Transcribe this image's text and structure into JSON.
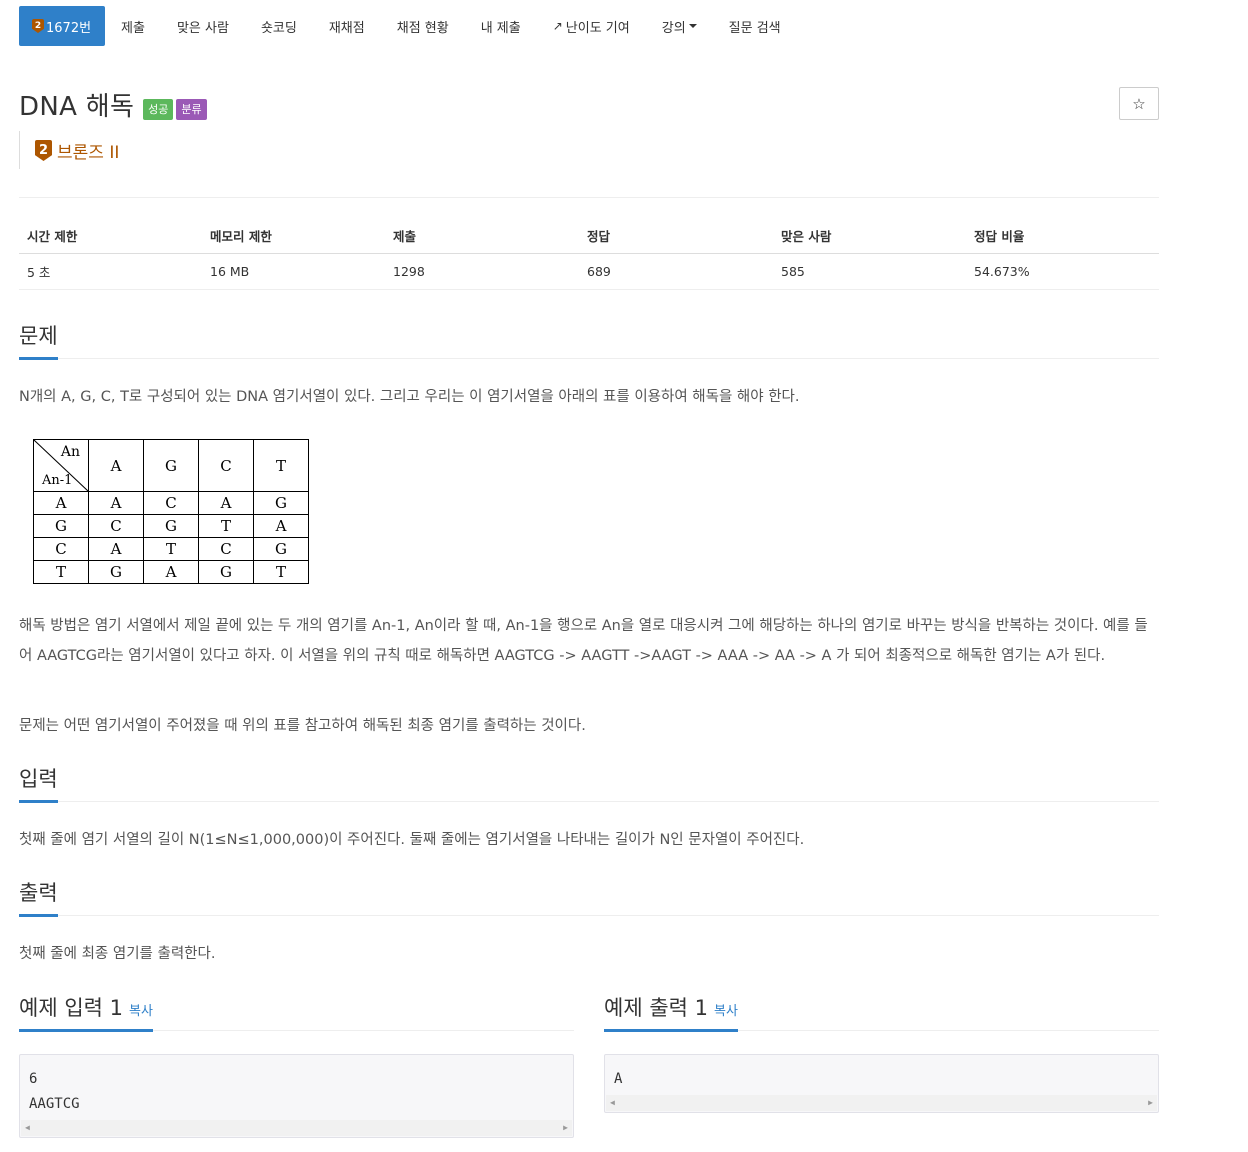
{
  "nav": {
    "active_tab": "1672번",
    "tier_digit": "2",
    "tabs": [
      "제출",
      "맞은 사람",
      "숏코딩",
      "재채점",
      "채점 현황",
      "내 제출",
      "난이도 기여",
      "강의",
      "질문 검색"
    ]
  },
  "problem": {
    "title": "DNA 해독",
    "labels": [
      "성공",
      "분류"
    ],
    "star": "☆",
    "tier_digit": "2",
    "tier_name": "브론즈 II"
  },
  "stats": {
    "headers": [
      "시간 제한",
      "메모리 제한",
      "제출",
      "정답",
      "맞은 사람",
      "정답 비율"
    ],
    "values": [
      "5 초",
      "16 MB",
      "1298",
      "689",
      "585",
      "54.673%"
    ]
  },
  "sections": {
    "problem_header": "문제",
    "problem_intro": "N개의 A, G, C, T로 구성되어 있는 DNA 염기서열이 있다. 그리고 우리는 이 염기서열을 아래의 표를 이용하여 해독을 해야 한다.",
    "problem_desc": "해독 방법은 염기 서열에서 제일 끝에 있는 두 개의 염기를 An-1, An이라 할 때, An-1을 행으로 An을 열로 대응시켜 그에 해당하는 하나의 염기로 바꾸는 방식을 반복하는 것이다.  예를 들어 AAGTCG라는 염기서열이 있다고 하자. 이 서열을 위의 규칙 때로 해독하면 AAGTCG -> AAGTT ->AAGT -> AAA -> AA -> A 가 되어 최종적으로 해독한 염기는 A가 된다.",
    "problem_task": "문제는 어떤 염기서열이 주어졌을 때 위의 표를 참고하여 해독된 최종 염기를 출력하는 것이다.",
    "input_header": "입력",
    "input_desc": "첫째 줄에 염기 서열의 길이 N(1≤N≤1,000,000)이 주어진다. 둘째 줄에는 염기서열을 나타내는 길이가 N인 문자열이 주어진다.",
    "output_header": "출력",
    "output_desc": "첫째 줄에 최종 염기를 출력한다.",
    "sample_input_header": "예제 입력 1",
    "sample_output_header": "예제 출력 1",
    "copy_label": "복사",
    "sample_input_lines": [
      "6",
      "AAGTCG"
    ],
    "sample_output_lines": [
      "A"
    ]
  },
  "dna_table": {
    "corner_top": "An",
    "corner_bottom": "An-1",
    "columns": [
      "A",
      "G",
      "C",
      "T"
    ],
    "rows": [
      {
        "key": "A",
        "cells": [
          "A",
          "C",
          "A",
          "G"
        ]
      },
      {
        "key": "G",
        "cells": [
          "C",
          "G",
          "T",
          "A"
        ]
      },
      {
        "key": "C",
        "cells": [
          "A",
          "T",
          "C",
          "G"
        ]
      },
      {
        "key": "T",
        "cells": [
          "G",
          "A",
          "G",
          "T"
        ]
      }
    ]
  },
  "colors": {
    "accent": "#2f80c9",
    "bronze": "#ad5600",
    "success": "#5cb85c",
    "category": "#9b59b6"
  }
}
